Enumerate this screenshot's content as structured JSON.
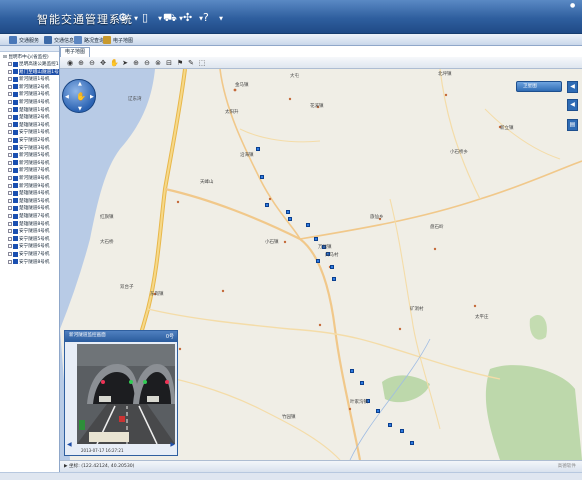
{
  "app": {
    "title": "智能交通管理系统"
  },
  "titlebar_icons": [
    "gear-icon",
    "phone-icon",
    "car-icon",
    "puzzle-icon",
    "help-icon"
  ],
  "toolbar": {
    "buttons": [
      {
        "label": "交通服务",
        "icon": "document-icon"
      },
      {
        "label": "交通信息",
        "icon": "car-icon"
      },
      {
        "label": "路况查询",
        "icon": "search-icon"
      },
      {
        "label": "电子地图",
        "icon": "pencil-icon"
      }
    ]
  },
  "tree": {
    "root": "昆明市中心(省监控)",
    "items": [
      {
        "label": "昆明高速公路监控1"
      },
      {
        "label": "易门至峨山隧道1号"
      },
      {
        "label": "新河隧道1号机"
      },
      {
        "label": "新河隧道2号机"
      },
      {
        "label": "新河隧道3号机"
      },
      {
        "label": "新河隧道4号机"
      },
      {
        "label": "楚雄隧道1号机"
      },
      {
        "label": "楚雄隧道2号机"
      },
      {
        "label": "楚雄隧道3号机"
      },
      {
        "label": "安宁隧道1号机"
      },
      {
        "label": "安宁隧道2号机"
      },
      {
        "label": "安宁隧道3号机"
      },
      {
        "label": "新河隧道5号机"
      },
      {
        "label": "新河隧道6号机"
      },
      {
        "label": "新河隧道7号机"
      },
      {
        "label": "新河隧道8号机"
      },
      {
        "label": "新河隧道9号机"
      },
      {
        "label": "楚雄隧道4号机"
      },
      {
        "label": "楚雄隧道5号机"
      },
      {
        "label": "楚雄隧道6号机"
      },
      {
        "label": "楚雄隧道7号机"
      },
      {
        "label": "楚雄隧道8号机"
      },
      {
        "label": "安宁隧道4号机"
      },
      {
        "label": "安宁隧道5号机"
      },
      {
        "label": "安宁隧道6号机"
      },
      {
        "label": "安宁隧道7号机"
      },
      {
        "label": "安宁隧道8号机"
      }
    ],
    "selected_index": 1
  },
  "map": {
    "tab": "电子地图",
    "layer_switch": "卫星图",
    "labels": [
      "辽东湾",
      "太阳升",
      "大屯",
      "北坪镇",
      "金马镇",
      "花溪镇",
      "小石桥乡",
      "万福镇",
      "旅仙乡",
      "新立镇",
      "大石桥",
      "矿洞村",
      "太平庄",
      "沿海镇",
      "小石镇",
      "白马村",
      "天峰山",
      "红旗镇",
      "双台子",
      "东岗镇",
      "竹园镇",
      "红旗岗",
      "宝盖子乡",
      "叶家沟镇",
      "盘石岭"
    ]
  },
  "video": {
    "title": "新河隧道监控画面",
    "group": "0号",
    "timestamp": "2013-07-17  16:27:21"
  },
  "status": {
    "coords": "坐标: (122.42124, 40.20530)",
    "right": "高德软件"
  }
}
